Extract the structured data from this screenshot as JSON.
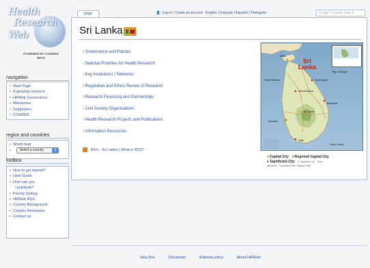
{
  "logo": {
    "line1": "Health",
    "line2": "Research",
    "line3": "Web",
    "powered": "POWERED BY COHRED",
    "beta": "BETA"
  },
  "navigation": {
    "heading": "navigation",
    "items": [
      "Main Page",
      "A growing resource",
      "HRWeb Governance",
      "Milestones",
      "Supporters",
      "COHRED"
    ]
  },
  "regions": {
    "heading": "region and countries",
    "items": [
      "World map"
    ],
    "select_value": "Select a country"
  },
  "toolbox": {
    "heading": "toolbox",
    "items": [
      "How to get started?",
      "User Guide",
      "How can you",
      "contribute?",
      "Priority Setting",
      "HRWeb RSS",
      "Country Background",
      "Country Reviewers",
      "Contact us"
    ]
  },
  "tabs": {
    "page": "page"
  },
  "personal": {
    "login": "Log in / Create an account",
    "languages": "English | Français | Español | Português"
  },
  "search": {
    "placeholder": "Google™ Custom Search"
  },
  "page": {
    "title": "Sri Lanka",
    "topics": [
      "Governance and Policies",
      "National Priorities for Health Research",
      "Key Institutions / Networks",
      "Regulation and Ethics Review of Research",
      "Research Financing and Partnerships",
      "Civil Society Organisations",
      "Health Research Projects and Publications",
      "Information Resources"
    ],
    "rss": "RSS - Sri Lanka | What is RSS?"
  },
  "map": {
    "box_title": "SRI LANKA",
    "title_line1": "Sri",
    "title_line2": "Lanka",
    "labels": [
      "Jaffna",
      "Trincomalee",
      "Anuradhapura",
      "Kandy",
      "Colombo",
      "Galle",
      "Batticaloa",
      "Gulf of Mannar",
      "Bay of Bengal",
      "Indian Ocean"
    ],
    "legend": {
      "capital": "Capital City",
      "regional": "Regional Capital City",
      "significant": "Significant City",
      "important": "Important City · Town",
      "row3": "Attraction · Landmark   River   Highest Point"
    }
  },
  "footer": {
    "links": [
      "Idea Box",
      "Disclaimer",
      "Editorial policy",
      "About HRWeb"
    ]
  }
}
